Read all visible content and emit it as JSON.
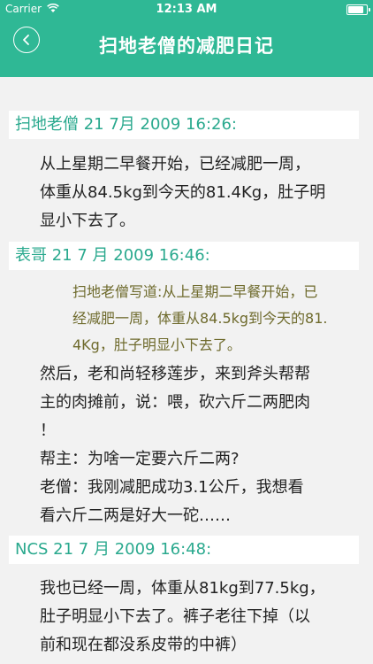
{
  "status_bar": {
    "carrier": "Carrier",
    "time": "12:13 AM",
    "battery_level": 0.95
  },
  "nav": {
    "title": "扫地老僧的减肥日记",
    "back_icon": "chevron-left-icon"
  },
  "colors": {
    "accent": "#2fb895",
    "author": "#2aa98e",
    "quote": "#6e6a2c"
  },
  "posts": [
    {
      "header": "扫地老僧 21 7月 2009 16:26:",
      "lines": [
        "从上星期二早餐开始，已经减肥一周，",
        "体重从84.5kg到今天的81.4Kg，肚子明",
        "显小下去了。"
      ]
    },
    {
      "header": "表哥 21 7 月 2009 16:46:",
      "quote_lines": [
        "扫地老僧写道:从上星期二早餐开始，已",
        "经减肥一周，体重从84.5kg到今天的81.",
        "4Kg，肚子明显小下去了。"
      ],
      "lines": [
        "然后，老和尚轻移莲步，来到斧头帮帮",
        "主的肉摊前，说：喂，砍六斤二两肥肉",
        "！",
        "帮主：为啥一定要六斤二两?",
        "老僧：我刚减肥成功3.1公斤，我想看",
        "看六斤二两是好大一砣……"
      ]
    },
    {
      "header": "NCS 21 7 月 2009 16:48:",
      "lines": [
        "我也已经一周，体重从81kg到77.5kg，",
        "肚子明显小下去了。裤子老往下掉（以",
        "前和现在都没系皮带的中裤）"
      ]
    }
  ]
}
